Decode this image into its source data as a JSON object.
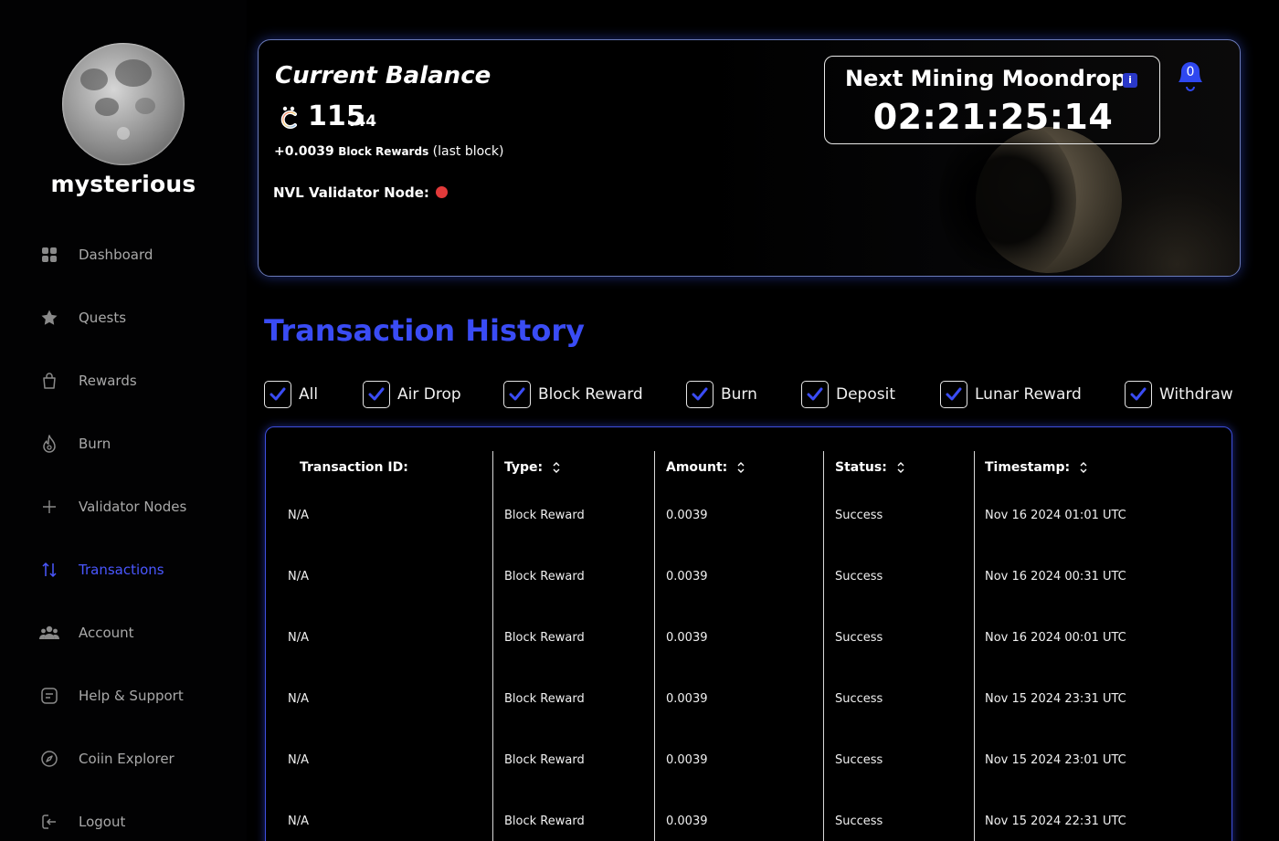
{
  "user": {
    "name": "mysterious"
  },
  "sidebar": {
    "items": [
      {
        "label": "Dashboard",
        "icon": "grid-icon"
      },
      {
        "label": "Quests",
        "icon": "star-icon"
      },
      {
        "label": "Rewards",
        "icon": "bag-icon"
      },
      {
        "label": "Burn",
        "icon": "flame-icon"
      },
      {
        "label": "Validator Nodes",
        "icon": "plus-icon"
      },
      {
        "label": "Transactions",
        "icon": "arrows-updown-icon",
        "active": true
      },
      {
        "label": "Account",
        "icon": "users-icon"
      },
      {
        "label": "Help & Support",
        "icon": "message-icon"
      },
      {
        "label": "Coiin Explorer",
        "icon": "compass-icon"
      },
      {
        "label": "Logout",
        "icon": "logout-icon"
      }
    ]
  },
  "balance": {
    "title": "Current Balance",
    "integer": "115",
    "decimal": ".44",
    "reward_amount": "+0.0039",
    "reward_label": "Block Rewards",
    "reward_note": "(last block)",
    "validator_label": "NVL Validator Node:",
    "validator_status_color": "#e23a3a"
  },
  "moondrop": {
    "title": "Next Mining Moondrop:",
    "info_icon": "i",
    "countdown": "02:21:25:14"
  },
  "notifications": {
    "count": "0"
  },
  "history": {
    "title": "Transaction History",
    "filters": [
      "All",
      "Air Drop",
      "Block Reward",
      "Burn",
      "Deposit",
      "Lunar Reward",
      "Withdraw"
    ],
    "columns": [
      "Transaction ID:",
      "Type:",
      "Amount:",
      "Status:",
      "Timestamp:"
    ],
    "rows": [
      [
        "N/A",
        "Block Reward",
        "0.0039",
        "Success",
        "Nov 16 2024 01:01 UTC"
      ],
      [
        "N/A",
        "Block Reward",
        "0.0039",
        "Success",
        "Nov 16 2024 00:31 UTC"
      ],
      [
        "N/A",
        "Block Reward",
        "0.0039",
        "Success",
        "Nov 16 2024 00:01 UTC"
      ],
      [
        "N/A",
        "Block Reward",
        "0.0039",
        "Success",
        "Nov 15 2024 23:31 UTC"
      ],
      [
        "N/A",
        "Block Reward",
        "0.0039",
        "Success",
        "Nov 15 2024 23:01 UTC"
      ],
      [
        "N/A",
        "Block Reward",
        "0.0039",
        "Success",
        "Nov 15 2024 22:31 UTC"
      ]
    ]
  },
  "colors": {
    "accent": "#3a4cf5",
    "active_nav": "#4a57ff",
    "background": "#000000"
  }
}
